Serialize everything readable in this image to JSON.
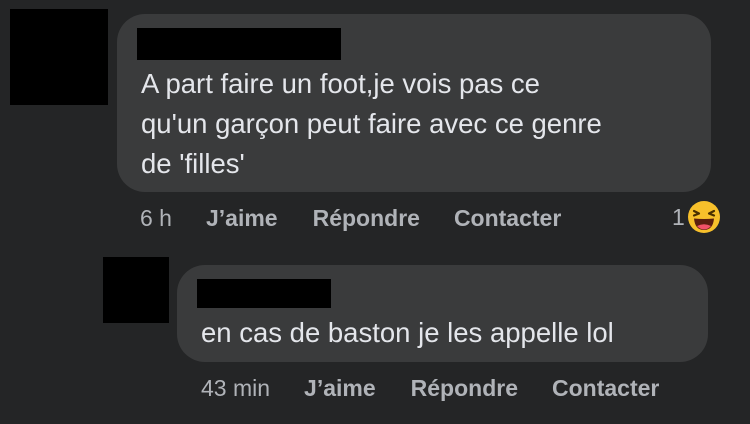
{
  "comments": [
    {
      "text": "A part faire un foot,je vois pas ce\nqu'un garçon peut faire avec ce genre\nde 'filles'",
      "time": "6 h",
      "actions": [
        "J’aime",
        "Répondre",
        "Contacter"
      ],
      "reaction": {
        "count": "1",
        "icon": "haha-emoji-icon"
      }
    },
    {
      "text": "en cas de baston je les appelle lol",
      "time": "43 min",
      "actions": [
        "J’aime",
        "Répondre",
        "Contacter"
      ]
    }
  ],
  "colors": {
    "background": "#242526",
    "bubble": "#3a3b3c",
    "primary_text": "#e4e6eb",
    "secondary_text": "#b0b3b8",
    "redaction": "#000000",
    "emoji_yellow": "#f7c02b"
  }
}
